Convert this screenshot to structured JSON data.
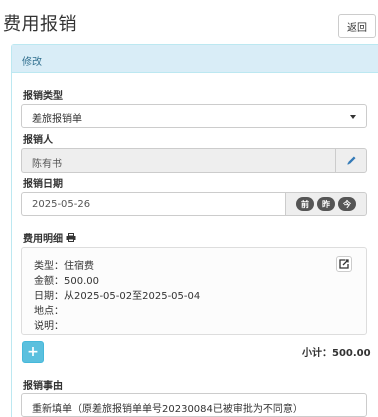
{
  "page": {
    "title": "费用报销",
    "back_label": "返回"
  },
  "panel": {
    "heading": "修改"
  },
  "form": {
    "type": {
      "label": "报销类型",
      "selected": "差旅报销单"
    },
    "person": {
      "label": "报销人",
      "value": "陈有书"
    },
    "date": {
      "label": "报销日期",
      "value": "2025-05-26",
      "buttons": [
        "前",
        "昨",
        "今"
      ]
    },
    "details": {
      "label": "费用明细",
      "items": [
        {
          "type_line": "类型：住宿费",
          "amount_line": "金额：500.00",
          "date_line": "日期：从2025-05-02至2025-05-04",
          "place_line": "地点：",
          "note_line": "说明："
        }
      ],
      "add_label": "+",
      "subtotal_label": "小计：",
      "subtotal_value": "500.00"
    },
    "reason": {
      "label": "报销事由",
      "value": "重新填单（原差旅报销单单号20230084已被审批为不同意）"
    }
  },
  "icons": {
    "edit": "pencil-icon",
    "print": "print-icon",
    "copy": "copy-icon",
    "dropdown": "caret-down-icon"
  },
  "colors": {
    "panel_heading_bg": "#d9edf7",
    "panel_heading_text": "#31708f",
    "add_button": "#5bc0de",
    "pencil": "#337ab7",
    "pill": "#555555"
  }
}
